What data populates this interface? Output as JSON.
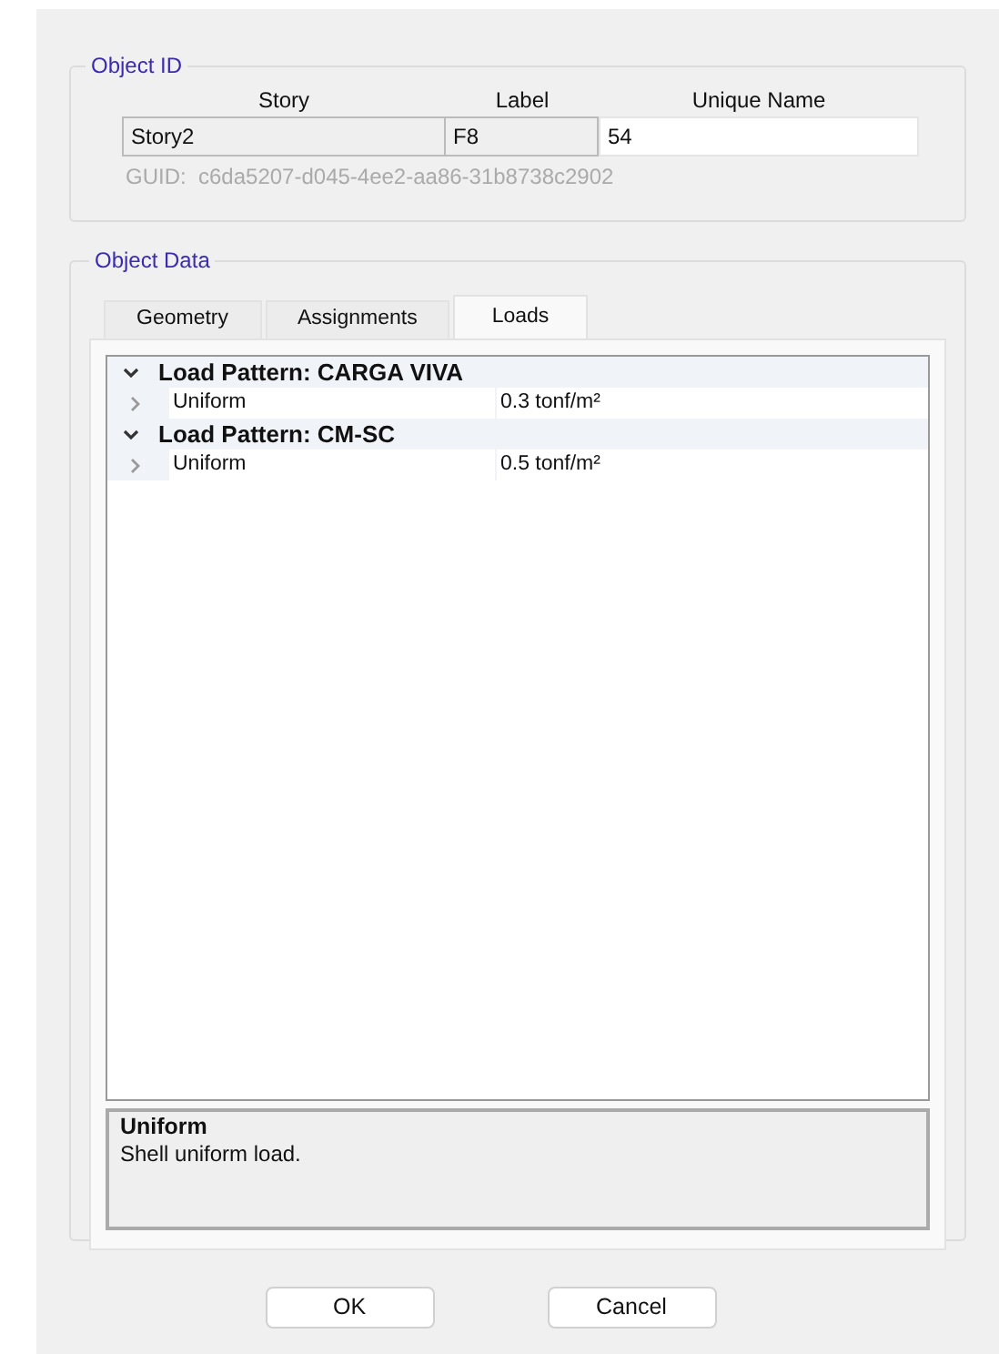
{
  "object_id": {
    "title": "Object ID",
    "columns": [
      "Story",
      "Label",
      "Unique Name"
    ],
    "story": "Story2",
    "label": "F8",
    "unique_name": "54",
    "guid": "GUID:  c6da5207-d045-4ee2-aa86-31b8738c2902"
  },
  "object_data": {
    "title": "Object Data",
    "tabs": [
      {
        "label": "Geometry",
        "selected": false
      },
      {
        "label": "Assignments",
        "selected": false
      },
      {
        "label": "Loads",
        "selected": true
      }
    ],
    "tree": [
      {
        "label": "Load Pattern: CARGA VIVA",
        "expanded": true,
        "children": [
          {
            "name": "Uniform",
            "value": "0.3 tonf/m²",
            "expanded": false
          }
        ]
      },
      {
        "label": "Load Pattern: CM-SC",
        "expanded": true,
        "children": [
          {
            "name": "Uniform",
            "value": "0.5 tonf/m²",
            "expanded": false
          }
        ]
      }
    ],
    "description": {
      "title": "Uniform",
      "text": "Shell uniform load."
    }
  },
  "buttons": [
    "OK",
    "Cancel"
  ]
}
